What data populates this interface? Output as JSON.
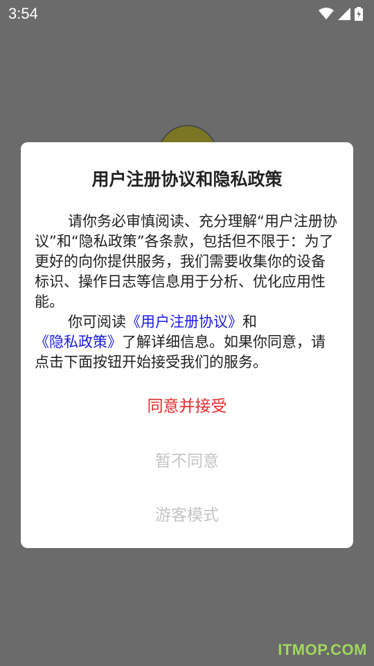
{
  "status_bar": {
    "time": "3:54",
    "icons": [
      "wifi-icon",
      "cellular-signal-icon",
      "battery-charging-icon"
    ]
  },
  "dialog": {
    "title": "用户注册协议和隐私政策",
    "paragraph1": "请你务必审慎阅读、充分理解“用户注册协议”和“隐私政策”各条款，包括但不限于：为了更好的向你提供服务，我们需要收集你的设备标识、操作日志等信息用于分析、优化应用性能。",
    "paragraph2_prefix": "你可阅读",
    "link_user_agreement": "《用户注册协议》",
    "paragraph2_and": "和",
    "link_privacy_policy": "《隐私政策》",
    "paragraph2_suffix": "了解详细信息。如果你同意，请点击下面按钮开始接受我们的服务。",
    "agree_button": "同意并接受",
    "disagree_button": "暂不同意",
    "guest_button": "游客模式"
  },
  "watermark": "ITMOP.COM",
  "colors": {
    "background_overlay": "#6b6b6b",
    "agree": "#e02c2c",
    "link": "#1a1ae6",
    "disabled": "#c4c4c4"
  }
}
